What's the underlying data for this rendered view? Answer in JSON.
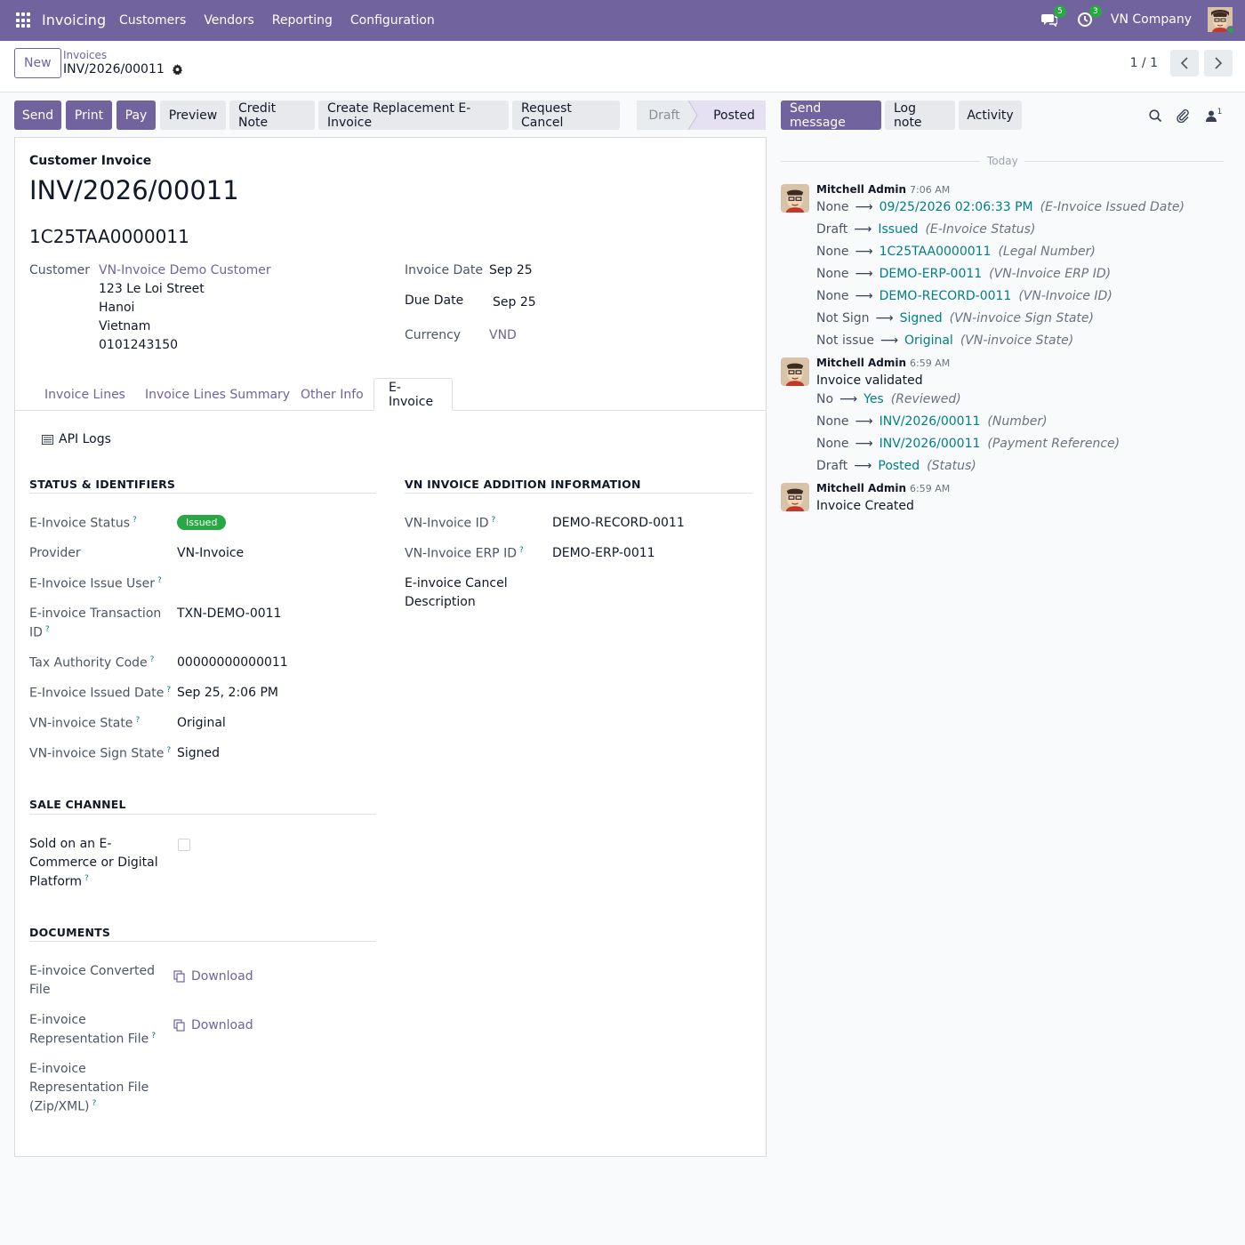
{
  "navbar": {
    "app_name": "Invoicing",
    "menu": [
      "Customers",
      "Vendors",
      "Reporting",
      "Configuration"
    ],
    "messages_count": "5",
    "activities_count": "3",
    "company": "VN Company"
  },
  "control_panel": {
    "new_label": "New",
    "breadcrumb_parent": "Invoices",
    "breadcrumb_current": "INV/2026/00011",
    "pager": "1 / 1"
  },
  "actions": {
    "send": "Send",
    "print": "Print",
    "pay": "Pay",
    "preview": "Preview",
    "credit_note": "Credit Note",
    "replacement": "Create Replacement E-Invoice",
    "request_cancel": "Request Cancel"
  },
  "statusbar": {
    "draft": "Draft",
    "posted": "Posted"
  },
  "form": {
    "type": "Customer Invoice",
    "name": "INV/2026/00011",
    "legal_number": "1C25TAA0000011",
    "customer_label": "Customer",
    "customer_name": "VN-Invoice Demo Customer",
    "address": [
      "123 Le Loi Street",
      "Hanoi",
      "Vietnam",
      "0101243150"
    ],
    "invoice_date_label": "Invoice Date",
    "invoice_date": "Sep 25",
    "due_date_label": "Due Date",
    "due_date": "Sep 25",
    "currency_label": "Currency",
    "currency": "VND"
  },
  "tabs": [
    "Invoice Lines",
    "Invoice Lines Summary",
    "Other Info",
    "E-Invoice"
  ],
  "einvoice": {
    "api_logs": "API Logs",
    "status_section": "STATUS & IDENTIFIERS",
    "addition_section": "VN INVOICE ADDITION INFORMATION",
    "status_label": "E-Invoice Status",
    "status_value": "Issued",
    "provider_label": "Provider",
    "provider_value": "VN-Invoice",
    "issue_user_label": "E-Invoice Issue User",
    "txn_label_1": "E-invoice Transaction",
    "txn_label_2": "ID",
    "txn_value": "TXN-DEMO-0011",
    "tax_code_label": "Tax Authority Code",
    "tax_code_value": "00000000000011",
    "issued_date_label": "E-Invoice Issued Date",
    "issued_date_value": "Sep 25, 2:06 PM",
    "state_label": "VN-invoice State",
    "state_value": "Original",
    "sign_state_label": "VN-invoice Sign State",
    "sign_state_value": "Signed",
    "vn_id_label": "VN-Invoice ID",
    "vn_id_value": "DEMO-RECORD-0011",
    "vn_erp_label": "VN-Invoice ERP ID",
    "vn_erp_value": "DEMO-ERP-0011",
    "cancel_desc_label_1": "E-invoice Cancel",
    "cancel_desc_label_2": "Description",
    "sale_section": "SALE CHANNEL",
    "sold_label_1": "Sold on an E-",
    "sold_label_2": "Commerce or Digital",
    "sold_label_3": "Platform",
    "documents_section": "DOCUMENTS",
    "converted_label_1": "E-invoice Converted",
    "converted_label_2": "File",
    "download": "Download",
    "repr_label_1": "E-invoice",
    "repr_label_2": "Representation File",
    "repr_zip_label_1": "E-invoice",
    "repr_zip_label_2": "Representation File",
    "repr_zip_label_3": "(Zip/XML)"
  },
  "chatter": {
    "send_message": "Send message",
    "log_note": "Log note",
    "activity": "Activity",
    "followers_count": "1",
    "today": "Today",
    "messages": [
      {
        "author": "Mitchell Admin",
        "time": "7:06 AM",
        "tracking": [
          {
            "old": "None",
            "new": "09/25/2026 02:06:33 PM",
            "field": "(E-Invoice Issued Date)"
          },
          {
            "old": "Draft",
            "new": "Issued",
            "field": "(E-Invoice Status)"
          },
          {
            "old": "None",
            "new": "1C25TAA0000011",
            "field": "(Legal Number)"
          },
          {
            "old": "None",
            "new": "DEMO-ERP-0011",
            "field": "(VN-Invoice ERP ID)"
          },
          {
            "old": "None",
            "new": "DEMO-RECORD-0011",
            "field": "(VN-Invoice ID)"
          },
          {
            "old": "Not Sign",
            "new": "Signed",
            "field": "(VN-invoice Sign State)"
          },
          {
            "old": "Not issue",
            "new": "Original",
            "field": "(VN-invoice State)"
          }
        ]
      },
      {
        "author": "Mitchell Admin",
        "time": "6:59 AM",
        "body": "Invoice validated",
        "tracking": [
          {
            "old": "No",
            "new": "Yes",
            "field": "(Reviewed)"
          },
          {
            "old": "None",
            "new": "INV/2026/00011",
            "field": "(Number)"
          },
          {
            "old": "None",
            "new": "INV/2026/00011",
            "field": "(Payment Reference)"
          },
          {
            "old": "Draft",
            "new": "Posted",
            "field": "(Status)"
          }
        ]
      },
      {
        "author": "Mitchell Admin",
        "time": "6:59 AM",
        "body": "Invoice Created"
      }
    ]
  },
  "colors": {
    "brand": "#71639e",
    "link_teal": "#017e84",
    "success": "#28a745"
  }
}
